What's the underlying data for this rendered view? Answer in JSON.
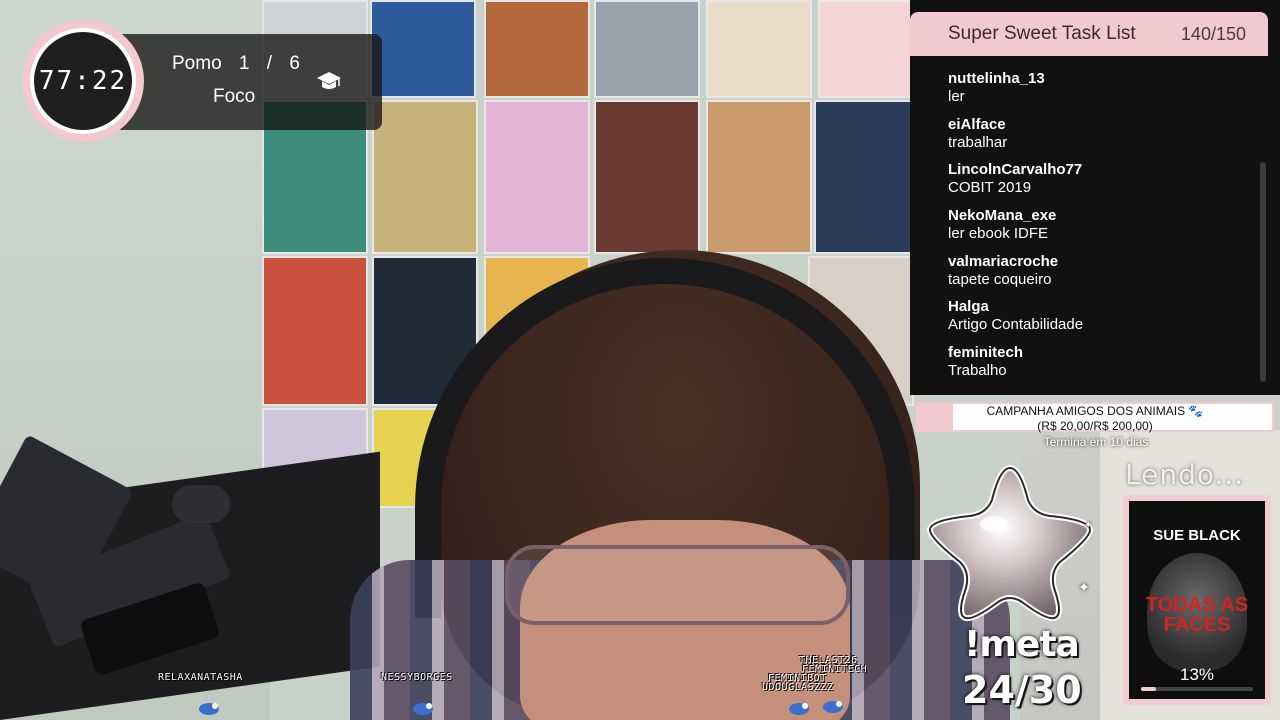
{
  "pomodoro": {
    "timer": "77:22",
    "label": "Pomo",
    "current": "1",
    "separator": "/",
    "total": "6",
    "mode": "Foco",
    "icon": "graduation-cap-icon"
  },
  "task_list": {
    "title": "Super Sweet Task List",
    "count": "140/150",
    "tasks": [
      {
        "user": "nuttelinha_13",
        "task": "ler"
      },
      {
        "user": "eiAlface",
        "task": "trabalhar"
      },
      {
        "user": "LincolnCarvalho77",
        "task": "COBIT 2019"
      },
      {
        "user": "NekoMana_exe",
        "task": "ler ebook IDFE"
      },
      {
        "user": "valmariacroche",
        "task": "tapete coqueiro"
      },
      {
        "user": "Halga",
        "task": "Artigo Contabilidade"
      },
      {
        "user": "feminitech",
        "task": "Trabalho"
      }
    ]
  },
  "campaign": {
    "title": "CAMPANHA AMIGOS DOS ANIMAIS 🐾",
    "amount": "(R$ 20,00/R$ 200,00)",
    "progress": 0.1,
    "ends": "Termina em 10 dias"
  },
  "meta": {
    "command": "!meta",
    "count": "24/30"
  },
  "reading": {
    "label": "Lendo...",
    "author": "SUE BLACK",
    "title": "TODAS AS FACES",
    "progress_percent": "13%",
    "progress": 0.13
  },
  "viewers": [
    "RELAXANATASHA",
    "NESSYBORGES",
    "THELAST26",
    "FEMINITECH",
    "FEMINIBOT",
    "UDOUGLASZZZ"
  ],
  "colors": {
    "accent_pink": "#f2c9cf",
    "panel_dark": "#121212"
  }
}
